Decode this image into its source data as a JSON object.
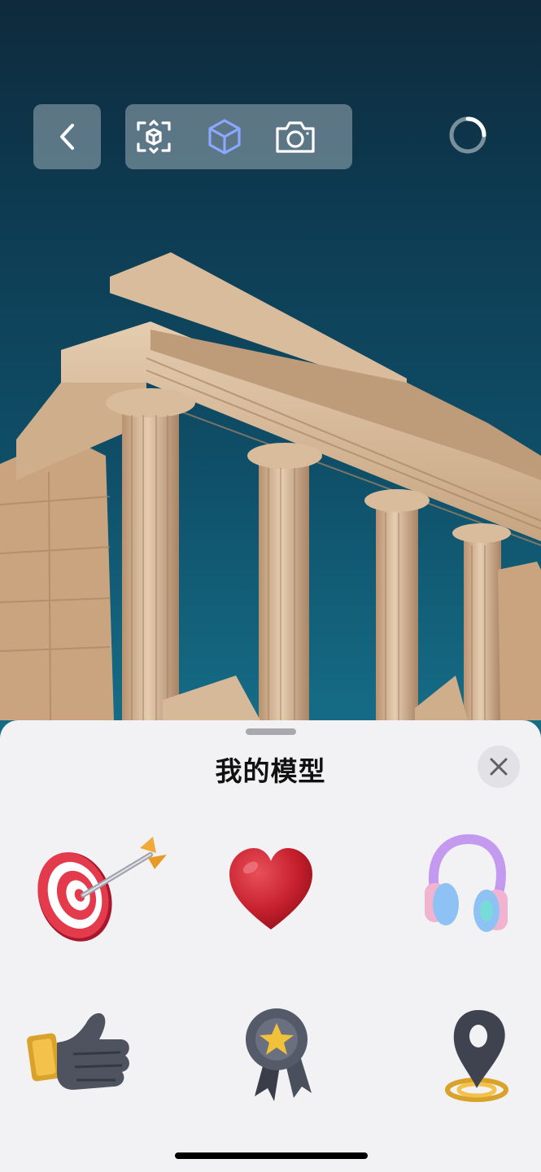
{
  "sheet": {
    "title": "我的模型",
    "models": [
      {
        "icon": "target-arrow-icon"
      },
      {
        "icon": "heart-icon"
      },
      {
        "icon": "headphones-icon"
      },
      {
        "icon": "thumbs-up-icon"
      },
      {
        "icon": "medal-star-icon"
      },
      {
        "icon": "location-pin-icon"
      }
    ]
  },
  "toolbar": {
    "icons": [
      "back-chevron-icon",
      "ar-scan-icon",
      "cube-icon",
      "camera-icon",
      "loading-spinner-icon"
    ]
  },
  "colors": {
    "sky_top": "#0e2a3c",
    "sky_bottom": "#1d86a0",
    "stone": "#d9bb9a",
    "accent_cube": "#8aa8ff",
    "sheet_bg": "#f2f2f4"
  }
}
